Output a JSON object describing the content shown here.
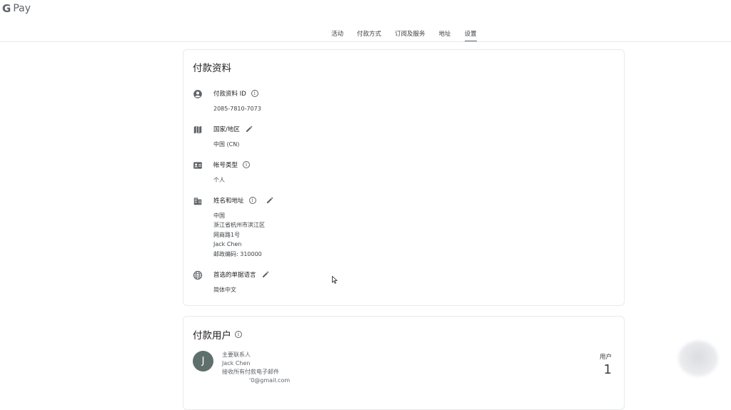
{
  "app": {
    "logo_g": "G",
    "logo_text": "Pay"
  },
  "nav": {
    "tabs": [
      {
        "label": "活动"
      },
      {
        "label": "付款方式"
      },
      {
        "label": "订阅及服务"
      },
      {
        "label": "地址"
      },
      {
        "label": "设置",
        "active": true
      }
    ]
  },
  "profile": {
    "title": "付款资料",
    "fields": [
      {
        "label": "付款资料 ID",
        "icon": "account-circle-icon",
        "value": "2085-7810-7073"
      },
      {
        "label": "国家/地区",
        "icon": "map-icon",
        "value": "中国 (CN)"
      },
      {
        "label": "帐号类型",
        "icon": "id-card-icon",
        "value": "个人"
      },
      {
        "label": "姓名和地址",
        "icon": "building-icon",
        "lines": [
          "中国",
          "浙江省杭州市滨江区",
          "网商路1号",
          "Jack Chen",
          "邮政编码: 310000"
        ]
      },
      {
        "label": "首选的单据语言",
        "icon": "globe-icon",
        "value": "简体中文"
      }
    ]
  },
  "users": {
    "title": "付款用户",
    "user": {
      "avatar_letter": "J",
      "role": "主要联系人",
      "name": "Jack Chen",
      "note": "接收所有付款电子邮件",
      "email": "'0@gmail.com"
    },
    "count_label": "用户",
    "count": "1"
  },
  "colors": {
    "accent": "#5f6368",
    "avatar_bg": "#5f6f6c",
    "divider": "#e8eaed"
  }
}
